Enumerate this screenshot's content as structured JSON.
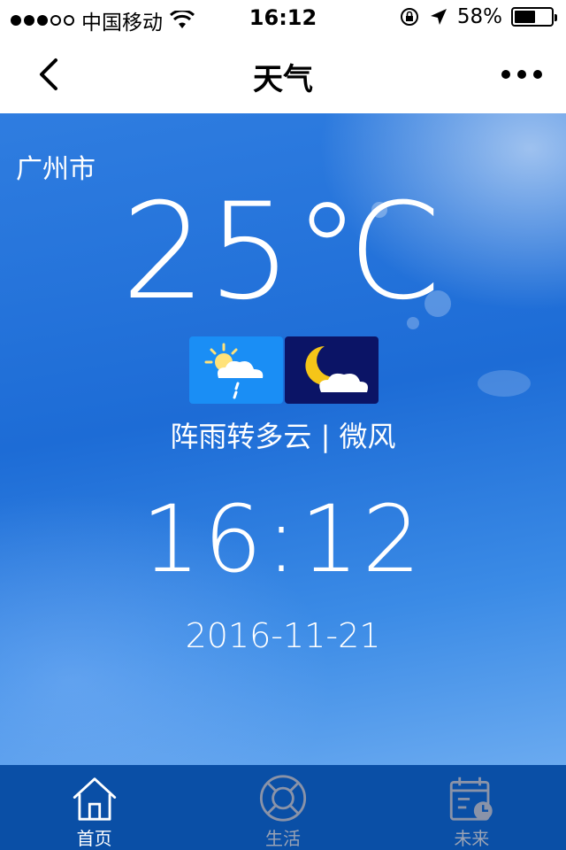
{
  "status_bar": {
    "carrier": "中国移动",
    "time": "16:12",
    "battery_percent": "58%",
    "battery_level": 0.58,
    "signal_bars_filled": 3,
    "signal_bars_total": 5
  },
  "nav": {
    "title": "天气",
    "back_icon": "chevron-left-icon",
    "more_icon": "more-dots-icon"
  },
  "weather": {
    "city": "广州市",
    "temperature": "25℃",
    "day_icon": "sun-cloud-rain-icon",
    "night_icon": "moon-cloud-icon",
    "description": "阵雨转多云 | 微风",
    "clock": "16:12",
    "date": "2016-11-21"
  },
  "tabs": [
    {
      "label": "首页",
      "icon": "home-icon",
      "active": true
    },
    {
      "label": "生活",
      "icon": "lifebuoy-icon",
      "active": false
    },
    {
      "label": "未来",
      "icon": "calendar-clock-icon",
      "active": false
    }
  ],
  "colors": {
    "tab_bar": "#0a4fa6",
    "day_icon_bg": "#1a8ef5",
    "night_icon_bg": "#0b1466",
    "moon": "#f5c518"
  }
}
